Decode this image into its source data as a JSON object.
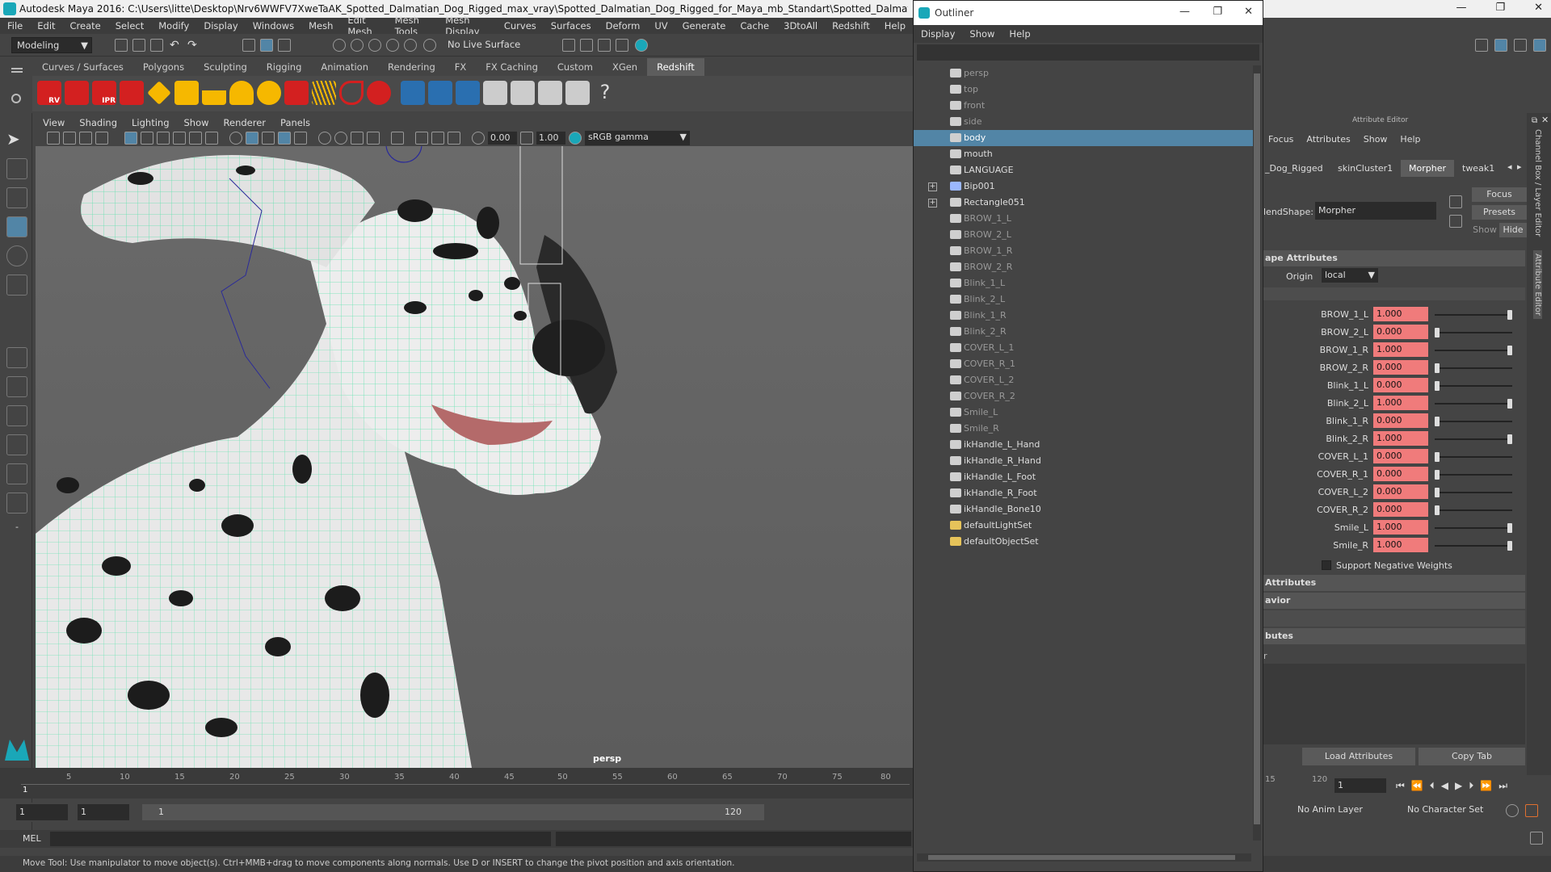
{
  "window": {
    "title": "Autodesk Maya 2016: C:\\Users\\litte\\Desktop\\Nrv6WWFV7XweTaAK_Spotted_Dalmatian_Dog_Rigged_max_vray\\Spotted_Dalmatian_Dog_Rigged_for_Maya_mb_Standart\\Spotted_Dalmatian_Dog_Rigged_for_May",
    "minimize": "—",
    "maximize": "❐",
    "close": "✕"
  },
  "menubar": [
    "File",
    "Edit",
    "Create",
    "Select",
    "Modify",
    "Display",
    "Windows",
    "Mesh",
    "Edit Mesh",
    "Mesh Tools",
    "Mesh Display",
    "Curves",
    "Surfaces",
    "Deform",
    "UV",
    "Generate",
    "Cache",
    "- 3DtoAll -",
    "Redshift",
    "Help"
  ],
  "statusline": {
    "mode": "Modeling",
    "live_surface": "No Live Surface"
  },
  "shelf": {
    "tabs": [
      "Curves / Surfaces",
      "Polygons",
      "Sculpting",
      "Rigging",
      "Animation",
      "Rendering",
      "FX",
      "FX Caching",
      "Custom",
      "XGen",
      "Redshift"
    ],
    "active_tab": "Redshift",
    "icon_labels": [
      "RV",
      "IPR"
    ]
  },
  "viewport": {
    "menu": [
      "View",
      "Shading",
      "Lighting",
      "Show",
      "Renderer",
      "Panels"
    ],
    "exposure": "0.00",
    "gamma": "1.00",
    "colorspace": "sRGB gamma",
    "camera_label": "persp"
  },
  "timeline": {
    "ticks": [
      "5",
      "10",
      "15",
      "20",
      "25",
      "30",
      "35",
      "40",
      "45",
      "50",
      "55",
      "60",
      "65",
      "70",
      "75",
      "80"
    ],
    "current_frame": "1",
    "range_start": "1",
    "range_inner_start": "1",
    "range_slider_start": "1",
    "range_slider_end": "120"
  },
  "mel": {
    "label": "MEL"
  },
  "helpline": "Move Tool: Use manipulator to move object(s). Ctrl+MMB+drag to move components along normals. Use D or INSERT to change the pivot position and axis orientation.",
  "outliner": {
    "title": "Outliner",
    "menu": [
      "Display",
      "Show",
      "Help"
    ],
    "items": [
      {
        "label": "persp",
        "icon": "camera-icon",
        "dim": true
      },
      {
        "label": "top",
        "icon": "camera-icon",
        "dim": true
      },
      {
        "label": "front",
        "icon": "camera-icon",
        "dim": true
      },
      {
        "label": "side",
        "icon": "camera-icon",
        "dim": true
      },
      {
        "label": "body",
        "icon": "mesh-icon",
        "selected": true
      },
      {
        "label": "mouth",
        "icon": "mesh-icon"
      },
      {
        "label": "LANGUAGE",
        "icon": "mesh-icon"
      },
      {
        "label": "Bip001",
        "icon": "joint-icon",
        "expand": true
      },
      {
        "label": "Rectangle051",
        "icon": "mesh-icon",
        "expand": true
      },
      {
        "label": "BROW_1_L",
        "icon": "mesh-icon",
        "dim": true
      },
      {
        "label": "BROW_2_L",
        "icon": "mesh-icon",
        "dim": true
      },
      {
        "label": "BROW_1_R",
        "icon": "mesh-icon",
        "dim": true
      },
      {
        "label": "BROW_2_R",
        "icon": "mesh-icon",
        "dim": true
      },
      {
        "label": "Blink_1_L",
        "icon": "mesh-icon",
        "dim": true
      },
      {
        "label": "Blink_2_L",
        "icon": "mesh-icon",
        "dim": true
      },
      {
        "label": "Blink_1_R",
        "icon": "mesh-icon",
        "dim": true
      },
      {
        "label": "Blink_2_R",
        "icon": "mesh-icon",
        "dim": true
      },
      {
        "label": "COVER_L_1",
        "icon": "mesh-icon",
        "dim": true
      },
      {
        "label": "COVER_R_1",
        "icon": "mesh-icon",
        "dim": true
      },
      {
        "label": "COVER_L_2",
        "icon": "mesh-icon",
        "dim": true
      },
      {
        "label": "COVER_R_2",
        "icon": "mesh-icon",
        "dim": true
      },
      {
        "label": "Smile_L",
        "icon": "mesh-icon",
        "dim": true
      },
      {
        "label": "Smile_R",
        "icon": "mesh-icon",
        "dim": true
      },
      {
        "label": "ikHandle_L_Hand",
        "icon": "ikhandle-icon"
      },
      {
        "label": "ikHandle_R_Hand",
        "icon": "ikhandle-icon"
      },
      {
        "label": "ikHandle_L_Foot",
        "icon": "ikhandle-icon"
      },
      {
        "label": "ikHandle_R_Foot",
        "icon": "ikhandle-icon"
      },
      {
        "label": "ikHandle_Bone10",
        "icon": "ikhandle-icon"
      },
      {
        "label": "defaultLightSet",
        "icon": "set-icon"
      },
      {
        "label": "defaultObjectSet",
        "icon": "set-icon"
      }
    ]
  },
  "attribute_editor": {
    "title": "Attribute Editor",
    "menu": [
      "Focus",
      "Attributes",
      "Show",
      "Help"
    ],
    "tabs": [
      "_Dog_Rigged",
      "skinCluster1",
      "Morpher",
      "tweak1"
    ],
    "active_tab": "Morpher",
    "blendshape_label": "lendShape:",
    "blendshape_value": "Morpher",
    "focus_button": "Focus",
    "presets_button": "Presets",
    "show_button": "Show",
    "hide_button": "Hide",
    "section_shape": "ape Attributes",
    "origin_label": "Origin",
    "origin_value": "local",
    "weights": [
      {
        "name": "BROW_1_L",
        "value": "1.000",
        "level": 1
      },
      {
        "name": "BROW_2_L",
        "value": "0.000",
        "level": 0
      },
      {
        "name": "BROW_1_R",
        "value": "1.000",
        "level": 1
      },
      {
        "name": "BROW_2_R",
        "value": "0.000",
        "level": 0
      },
      {
        "name": "Blink_1_L",
        "value": "0.000",
        "level": 0
      },
      {
        "name": "Blink_2_L",
        "value": "1.000",
        "level": 1
      },
      {
        "name": "Blink_1_R",
        "value": "0.000",
        "level": 0
      },
      {
        "name": "Blink_2_R",
        "value": "1.000",
        "level": 1
      },
      {
        "name": "COVER_L_1",
        "value": "0.000",
        "level": 0
      },
      {
        "name": "COVER_R_1",
        "value": "0.000",
        "level": 0
      },
      {
        "name": "COVER_L_2",
        "value": "0.000",
        "level": 0
      },
      {
        "name": "COVER_R_2",
        "value": "0.000",
        "level": 0
      },
      {
        "name": "Smile_L",
        "value": "1.000",
        "level": 1
      },
      {
        "name": "Smile_R",
        "value": "1.000",
        "level": 1
      }
    ],
    "support_negative": "Support Negative Weights",
    "section_2": "Attributes",
    "section_3": "avior",
    "section_4": "butes",
    "section_5": "r",
    "load_button": "Load Attributes",
    "copy_button": "Copy Tab"
  },
  "right_strip": {
    "channel_box": "Channel Box / Layer Editor",
    "attribute_editor": "Attribute Editor"
  },
  "bottom_right": {
    "tick_15": "15",
    "tick_120": "120",
    "current_frame": "1",
    "anim_layer": "No Anim Layer",
    "char_set": "No Character Set"
  },
  "colors": {
    "selection": "#5285a6",
    "weight_field": "#f07b7b",
    "wireframe": "#3fe0a0"
  }
}
